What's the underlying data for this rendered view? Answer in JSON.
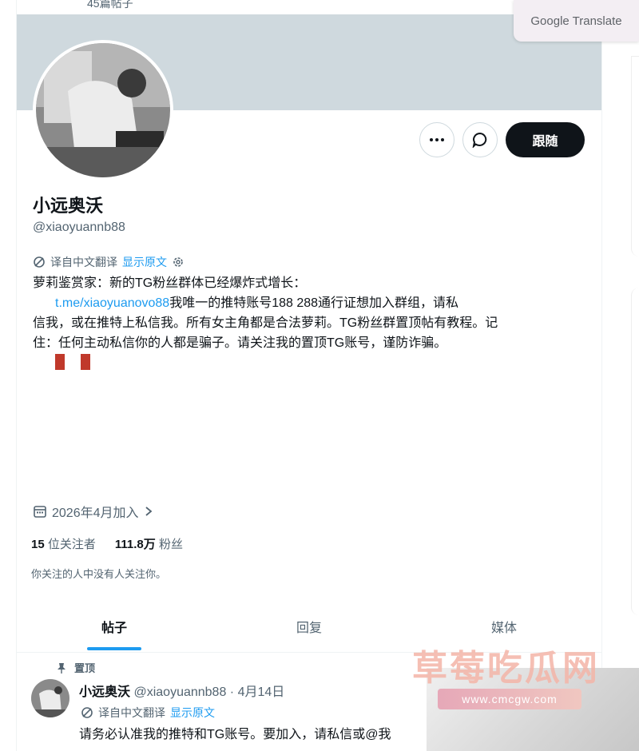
{
  "header": {
    "post_count": "45篇帖子"
  },
  "google_translate": {
    "label": "Google Translate"
  },
  "profile": {
    "name": "小远奥沃",
    "handle": "@xiaoyuannb88",
    "translated_label": "译自中文翻译",
    "show_original": "显示原文",
    "bio_line1": "萝莉鉴赏家：新的TG粉丝群体已经爆炸式增长：",
    "bio_link": "t.me/xiaoyuanovo88",
    "bio_line2": "我唯一的推特账号188 288通行证想加入群组，请私",
    "bio_line3": "信我，或在推特上私信我。所有女主角都是合法萝莉。TG粉丝群置顶帖有教程。记",
    "bio_line4": "住：任何主动私信你的人都是骗子。请关注我的置顶TG账号，谨防诈骗。",
    "joined": "2026年4月加入",
    "following_count": "15",
    "following_label": "位关注者",
    "followers_count": "111.8万",
    "followers_label": "粉丝",
    "mutual_note": "你关注的人中没有人关注你。"
  },
  "actions": {
    "follow": "跟随"
  },
  "tabs": [
    {
      "label": "帖子"
    },
    {
      "label": "回复"
    },
    {
      "label": "媒体"
    }
  ],
  "pinned_post": {
    "pinned_label": "置顶",
    "name": "小远奥沃",
    "handle_date": "@xiaoyuannb88 · 4月14日",
    "translated_label": "译自中文翻译",
    "show_original": "显示原文",
    "text": "请务必认准我的推特和TG账号。要加入，请私信或@我"
  },
  "watermark": {
    "text": "草莓吃瓜网",
    "url": "www.cmcgw.com"
  }
}
